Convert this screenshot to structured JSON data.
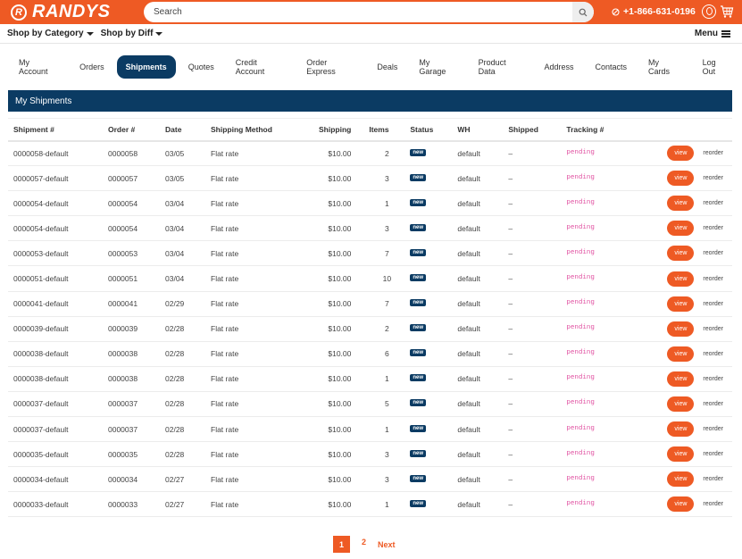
{
  "header": {
    "brand": "RANDYS",
    "search_placeholder": "Search",
    "phone": "+1-866-631-0196",
    "colors": {
      "brand_orange": "#ee5a24",
      "navy": "#0b3b63",
      "pending_pink": "#e04fa0"
    }
  },
  "subnav": {
    "shop_by_category": "Shop by Category",
    "shop_by_diff": "Shop by Diff",
    "menu": "Menu"
  },
  "account_nav": {
    "tabs": [
      {
        "label": "My Account",
        "active": false
      },
      {
        "label": "Orders",
        "active": false
      },
      {
        "label": "Shipments",
        "active": true
      },
      {
        "label": "Quotes",
        "active": false
      },
      {
        "label": "Credit Account",
        "active": false
      },
      {
        "label": "Order Express",
        "active": false
      },
      {
        "label": "Deals",
        "active": false
      },
      {
        "label": "My Garage",
        "active": false
      },
      {
        "label": "Product Data",
        "active": false
      },
      {
        "label": "Address",
        "active": false
      },
      {
        "label": "Contacts",
        "active": false
      },
      {
        "label": "My Cards",
        "active": false
      },
      {
        "label": "Log Out",
        "active": false
      }
    ]
  },
  "panel": {
    "title": "My Shipments"
  },
  "table": {
    "columns": [
      "Shipment #",
      "Order #",
      "Date",
      "Shipping Method",
      "Shipping",
      "Items",
      "Status",
      "WH",
      "Shipped",
      "Tracking #",
      ""
    ],
    "view_label": "view",
    "reorder_label": "reorder",
    "rows": [
      {
        "shipment": "0000058-default",
        "order": "0000058",
        "date": "03/05",
        "method": "Flat rate",
        "shipping": "$10.00",
        "items": "2",
        "status": "new",
        "wh": "default",
        "shipped": "–",
        "tracking": "pending"
      },
      {
        "shipment": "0000057-default",
        "order": "0000057",
        "date": "03/05",
        "method": "Flat rate",
        "shipping": "$10.00",
        "items": "3",
        "status": "new",
        "wh": "default",
        "shipped": "–",
        "tracking": "pending"
      },
      {
        "shipment": "0000054-default",
        "order": "0000054",
        "date": "03/04",
        "method": "Flat rate",
        "shipping": "$10.00",
        "items": "1",
        "status": "new",
        "wh": "default",
        "shipped": "–",
        "tracking": "pending"
      },
      {
        "shipment": "0000054-default",
        "order": "0000054",
        "date": "03/04",
        "method": "Flat rate",
        "shipping": "$10.00",
        "items": "3",
        "status": "new",
        "wh": "default",
        "shipped": "–",
        "tracking": "pending"
      },
      {
        "shipment": "0000053-default",
        "order": "0000053",
        "date": "03/04",
        "method": "Flat rate",
        "shipping": "$10.00",
        "items": "7",
        "status": "new",
        "wh": "default",
        "shipped": "–",
        "tracking": "pending"
      },
      {
        "shipment": "0000051-default",
        "order": "0000051",
        "date": "03/04",
        "method": "Flat rate",
        "shipping": "$10.00",
        "items": "10",
        "status": "new",
        "wh": "default",
        "shipped": "–",
        "tracking": "pending"
      },
      {
        "shipment": "0000041-default",
        "order": "0000041",
        "date": "02/29",
        "method": "Flat rate",
        "shipping": "$10.00",
        "items": "7",
        "status": "new",
        "wh": "default",
        "shipped": "–",
        "tracking": "pending"
      },
      {
        "shipment": "0000039-default",
        "order": "0000039",
        "date": "02/28",
        "method": "Flat rate",
        "shipping": "$10.00",
        "items": "2",
        "status": "new",
        "wh": "default",
        "shipped": "–",
        "tracking": "pending"
      },
      {
        "shipment": "0000038-default",
        "order": "0000038",
        "date": "02/28",
        "method": "Flat rate",
        "shipping": "$10.00",
        "items": "6",
        "status": "new",
        "wh": "default",
        "shipped": "–",
        "tracking": "pending"
      },
      {
        "shipment": "0000038-default",
        "order": "0000038",
        "date": "02/28",
        "method": "Flat rate",
        "shipping": "$10.00",
        "items": "1",
        "status": "new",
        "wh": "default",
        "shipped": "–",
        "tracking": "pending"
      },
      {
        "shipment": "0000037-default",
        "order": "0000037",
        "date": "02/28",
        "method": "Flat rate",
        "shipping": "$10.00",
        "items": "5",
        "status": "new",
        "wh": "default",
        "shipped": "–",
        "tracking": "pending"
      },
      {
        "shipment": "0000037-default",
        "order": "0000037",
        "date": "02/28",
        "method": "Flat rate",
        "shipping": "$10.00",
        "items": "1",
        "status": "new",
        "wh": "default",
        "shipped": "–",
        "tracking": "pending"
      },
      {
        "shipment": "0000035-default",
        "order": "0000035",
        "date": "02/28",
        "method": "Flat rate",
        "shipping": "$10.00",
        "items": "3",
        "status": "new",
        "wh": "default",
        "shipped": "–",
        "tracking": "pending"
      },
      {
        "shipment": "0000034-default",
        "order": "0000034",
        "date": "02/27",
        "method": "Flat rate",
        "shipping": "$10.00",
        "items": "3",
        "status": "new",
        "wh": "default",
        "shipped": "–",
        "tracking": "pending"
      },
      {
        "shipment": "0000033-default",
        "order": "0000033",
        "date": "02/27",
        "method": "Flat rate",
        "shipping": "$10.00",
        "items": "1",
        "status": "new",
        "wh": "default",
        "shipped": "–",
        "tracking": "pending"
      }
    ]
  },
  "pagination": {
    "current": "1",
    "page2": "2",
    "next": "Next"
  }
}
